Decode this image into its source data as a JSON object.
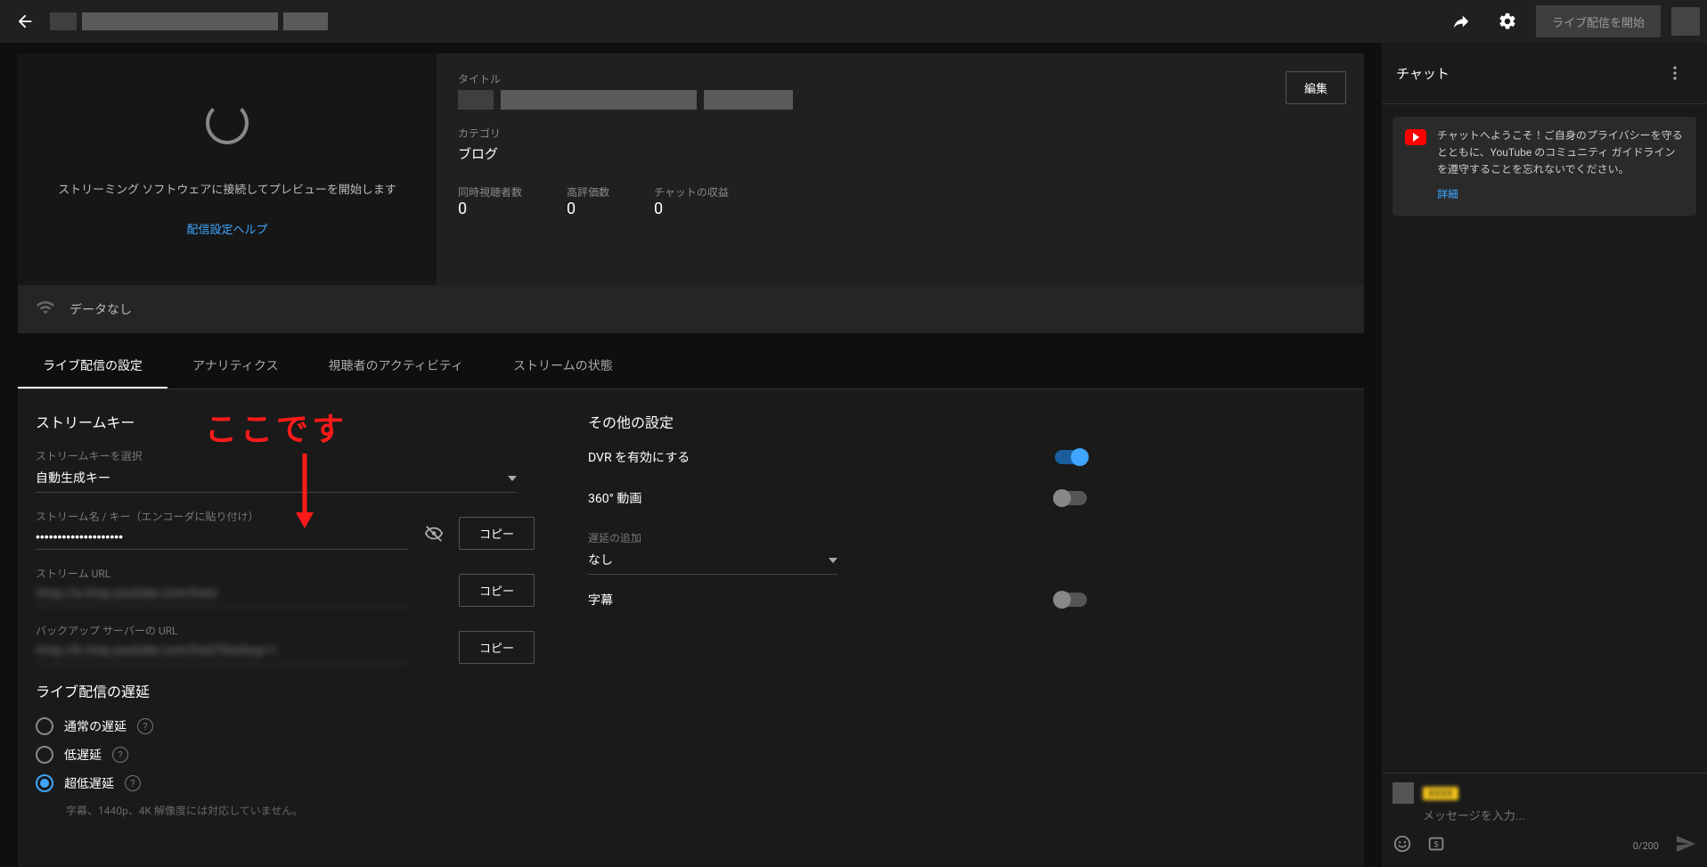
{
  "topbar": {
    "start_live_label": "ライブ配信を開始"
  },
  "preview": {
    "connect_text": "ストリーミング ソフトウェアに接続してプレビューを開始します",
    "help_link": "配信設定ヘルプ"
  },
  "info": {
    "title_label": "タイトル",
    "category_label": "カテゴリ",
    "category_value": "ブログ",
    "edit_label": "編集",
    "stats": {
      "viewers_label": "同時視聴者数",
      "viewers_value": "0",
      "likes_label": "高評価数",
      "likes_value": "0",
      "chat_rev_label": "チャットの収益",
      "chat_rev_value": "0"
    }
  },
  "status": {
    "data_none": "データなし"
  },
  "tabs": {
    "t0": "ライブ配信の設定",
    "t1": "アナリティクス",
    "t2": "視聴者のアクティビティ",
    "t3": "ストリームの状態"
  },
  "annotation_text": "ここです",
  "stream": {
    "section_title": "ストリームキー",
    "select_label": "ストリームキーを選択",
    "select_value": "自動生成キー",
    "name_key_label": "ストリーム名 / キー（エンコーダに貼り付け）",
    "name_key_value": "••••••••••••••••••••",
    "url_label": "ストリーム URL",
    "backup_label": "バックアップ サーバーの URL",
    "copy_label": "コピー"
  },
  "latency": {
    "section_title": "ライブ配信の遅延",
    "opt_normal": "通常の遅延",
    "opt_low": "低遅延",
    "opt_ultra": "超低遅延",
    "hint": "字幕、1440p、4K 解像度には対応していません。"
  },
  "other": {
    "section_title": "その他の設定",
    "dvr_label": "DVR を有効にする",
    "r360_label": "360° 動画",
    "delay_add_label": "遅延の追加",
    "delay_add_value": "なし",
    "subtitle_label": "字幕"
  },
  "chat": {
    "header": "チャット",
    "notice_text": "チャットへようこそ！ご自身のプライバシーを守るとともに、YouTube のコミュニティ ガイドラインを遵守することを忘れないでください。",
    "notice_link": "詳細",
    "input_placeholder": "メッセージを入力...",
    "counter": "0/200"
  }
}
